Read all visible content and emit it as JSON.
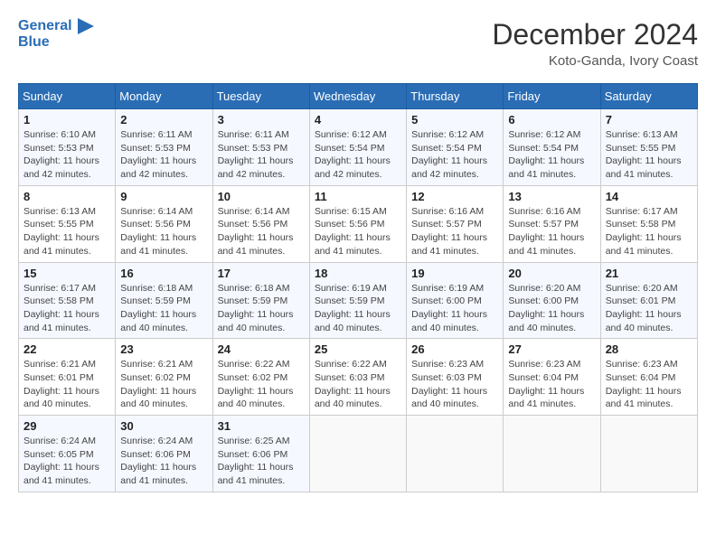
{
  "header": {
    "logo_line1": "General",
    "logo_line2": "Blue",
    "month_title": "December 2024",
    "location": "Koto-Ganda, Ivory Coast"
  },
  "weekdays": [
    "Sunday",
    "Monday",
    "Tuesday",
    "Wednesday",
    "Thursday",
    "Friday",
    "Saturday"
  ],
  "weeks": [
    [
      {
        "day": "1",
        "info": "Sunrise: 6:10 AM\nSunset: 5:53 PM\nDaylight: 11 hours\nand 42 minutes."
      },
      {
        "day": "2",
        "info": "Sunrise: 6:11 AM\nSunset: 5:53 PM\nDaylight: 11 hours\nand 42 minutes."
      },
      {
        "day": "3",
        "info": "Sunrise: 6:11 AM\nSunset: 5:53 PM\nDaylight: 11 hours\nand 42 minutes."
      },
      {
        "day": "4",
        "info": "Sunrise: 6:12 AM\nSunset: 5:54 PM\nDaylight: 11 hours\nand 42 minutes."
      },
      {
        "day": "5",
        "info": "Sunrise: 6:12 AM\nSunset: 5:54 PM\nDaylight: 11 hours\nand 42 minutes."
      },
      {
        "day": "6",
        "info": "Sunrise: 6:12 AM\nSunset: 5:54 PM\nDaylight: 11 hours\nand 41 minutes."
      },
      {
        "day": "7",
        "info": "Sunrise: 6:13 AM\nSunset: 5:55 PM\nDaylight: 11 hours\nand 41 minutes."
      }
    ],
    [
      {
        "day": "8",
        "info": "Sunrise: 6:13 AM\nSunset: 5:55 PM\nDaylight: 11 hours\nand 41 minutes."
      },
      {
        "day": "9",
        "info": "Sunrise: 6:14 AM\nSunset: 5:56 PM\nDaylight: 11 hours\nand 41 minutes."
      },
      {
        "day": "10",
        "info": "Sunrise: 6:14 AM\nSunset: 5:56 PM\nDaylight: 11 hours\nand 41 minutes."
      },
      {
        "day": "11",
        "info": "Sunrise: 6:15 AM\nSunset: 5:56 PM\nDaylight: 11 hours\nand 41 minutes."
      },
      {
        "day": "12",
        "info": "Sunrise: 6:16 AM\nSunset: 5:57 PM\nDaylight: 11 hours\nand 41 minutes."
      },
      {
        "day": "13",
        "info": "Sunrise: 6:16 AM\nSunset: 5:57 PM\nDaylight: 11 hours\nand 41 minutes."
      },
      {
        "day": "14",
        "info": "Sunrise: 6:17 AM\nSunset: 5:58 PM\nDaylight: 11 hours\nand 41 minutes."
      }
    ],
    [
      {
        "day": "15",
        "info": "Sunrise: 6:17 AM\nSunset: 5:58 PM\nDaylight: 11 hours\nand 41 minutes."
      },
      {
        "day": "16",
        "info": "Sunrise: 6:18 AM\nSunset: 5:59 PM\nDaylight: 11 hours\nand 40 minutes."
      },
      {
        "day": "17",
        "info": "Sunrise: 6:18 AM\nSunset: 5:59 PM\nDaylight: 11 hours\nand 40 minutes."
      },
      {
        "day": "18",
        "info": "Sunrise: 6:19 AM\nSunset: 5:59 PM\nDaylight: 11 hours\nand 40 minutes."
      },
      {
        "day": "19",
        "info": "Sunrise: 6:19 AM\nSunset: 6:00 PM\nDaylight: 11 hours\nand 40 minutes."
      },
      {
        "day": "20",
        "info": "Sunrise: 6:20 AM\nSunset: 6:00 PM\nDaylight: 11 hours\nand 40 minutes."
      },
      {
        "day": "21",
        "info": "Sunrise: 6:20 AM\nSunset: 6:01 PM\nDaylight: 11 hours\nand 40 minutes."
      }
    ],
    [
      {
        "day": "22",
        "info": "Sunrise: 6:21 AM\nSunset: 6:01 PM\nDaylight: 11 hours\nand 40 minutes."
      },
      {
        "day": "23",
        "info": "Sunrise: 6:21 AM\nSunset: 6:02 PM\nDaylight: 11 hours\nand 40 minutes."
      },
      {
        "day": "24",
        "info": "Sunrise: 6:22 AM\nSunset: 6:02 PM\nDaylight: 11 hours\nand 40 minutes."
      },
      {
        "day": "25",
        "info": "Sunrise: 6:22 AM\nSunset: 6:03 PM\nDaylight: 11 hours\nand 40 minutes."
      },
      {
        "day": "26",
        "info": "Sunrise: 6:23 AM\nSunset: 6:03 PM\nDaylight: 11 hours\nand 40 minutes."
      },
      {
        "day": "27",
        "info": "Sunrise: 6:23 AM\nSunset: 6:04 PM\nDaylight: 11 hours\nand 41 minutes."
      },
      {
        "day": "28",
        "info": "Sunrise: 6:23 AM\nSunset: 6:04 PM\nDaylight: 11 hours\nand 41 minutes."
      }
    ],
    [
      {
        "day": "29",
        "info": "Sunrise: 6:24 AM\nSunset: 6:05 PM\nDaylight: 11 hours\nand 41 minutes."
      },
      {
        "day": "30",
        "info": "Sunrise: 6:24 AM\nSunset: 6:06 PM\nDaylight: 11 hours\nand 41 minutes."
      },
      {
        "day": "31",
        "info": "Sunrise: 6:25 AM\nSunset: 6:06 PM\nDaylight: 11 hours\nand 41 minutes."
      },
      {
        "day": "",
        "info": ""
      },
      {
        "day": "",
        "info": ""
      },
      {
        "day": "",
        "info": ""
      },
      {
        "day": "",
        "info": ""
      }
    ]
  ]
}
